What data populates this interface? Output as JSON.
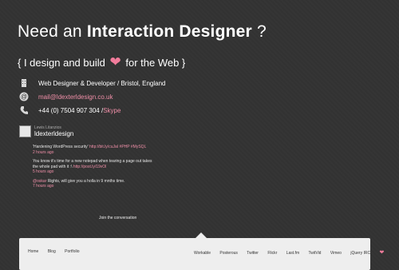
{
  "headline": {
    "part1": "Need  an ",
    "part2": "Interaction Designer",
    "part3": " ?"
  },
  "tagline": {
    "before": "{ I design and build ",
    "heart": "❤",
    "after": " for the Web }"
  },
  "info": {
    "role": "Web Designer & Developer / Bristol, England",
    "email": "mail@ldexterldesign.co.uk",
    "phone": "+44 (0) 7504 907 304 / ",
    "skype": "Skype"
  },
  "twitter": {
    "name": "Lewis Litanzios",
    "handle": "ldexterldesign",
    "tweets": [
      {
        "text": "'Hardening WordPress security' ",
        "link": "http://bit.ly/cuJaI #PHP #MySQL",
        "mention": "",
        "time": "2 hours ago"
      },
      {
        "text": "You know it's time for a new notepad when tearing a page out takes the whole pad with it :\\ ",
        "link": "http://post.ly/19vOl",
        "mention": "",
        "time": "5 hours ago"
      },
      {
        "text": " Rights, will give you a holla in 9 mnths time.",
        "link": "",
        "mention": "@oskar",
        "time": "7 hours ago"
      }
    ],
    "join": "Join the conversation"
  },
  "footer": {
    "left": [
      "Home",
      "Blog",
      "Portfolio"
    ],
    "right": [
      "Workable",
      "Posterous",
      "Twitter",
      "Flickr",
      "Last.fm",
      "TwitVid",
      "Vimeo",
      "jQuery IRC"
    ],
    "heart": "❤"
  },
  "colors": {
    "background": "#333333",
    "accent": "#f08fa8",
    "footer": "#eeeeee"
  }
}
